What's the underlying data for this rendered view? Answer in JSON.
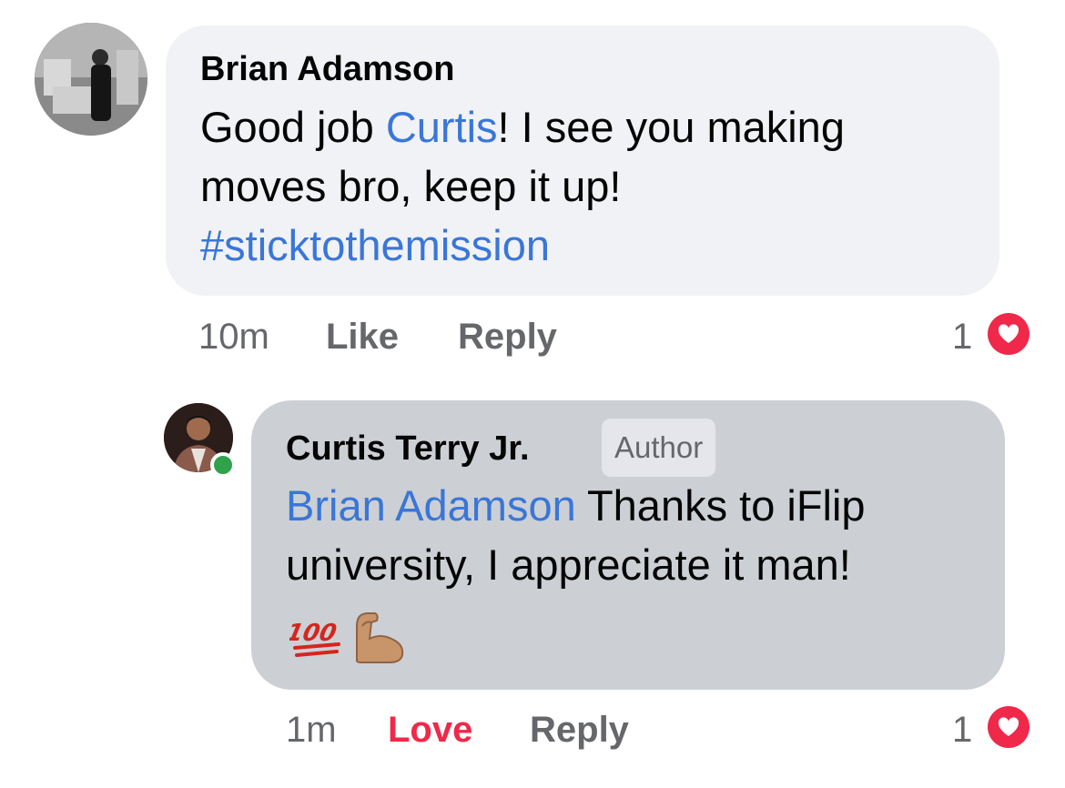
{
  "comments": [
    {
      "author": "Brian Adamson",
      "text_parts": {
        "pre": "Good job ",
        "mention": "Curtis",
        "post": "! I see you making",
        "line2": "moves bro, keep it up!",
        "hashtag": "#sticktothemission"
      },
      "time": "10m",
      "like_label": "Like",
      "reply_label": "Reply",
      "reaction_count": "1",
      "reaction_icon": "heart-icon"
    },
    {
      "author": "Curtis Terry Jr.",
      "badge": "Author",
      "text_parts": {
        "mention": "Brian Adamson",
        "post": " Thanks to iFlip",
        "line2": "university, I appreciate it man!",
        "emojis": [
          "100-emoji",
          "flexed-biceps-emoji"
        ]
      },
      "time": "1m",
      "like_label": "Love",
      "reply_label": "Reply",
      "reaction_count": "1",
      "reaction_icon": "heart-icon"
    }
  ],
  "colors": {
    "bubble_primary": "#f0f2f5",
    "bubble_reply": "#ccd0d5",
    "link": "#3a76d8",
    "love": "#f0284a",
    "meta": "#65676b"
  }
}
